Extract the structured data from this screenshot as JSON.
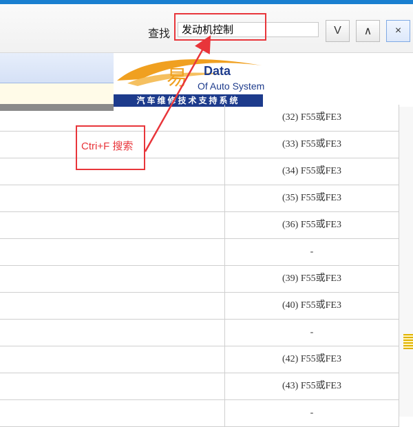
{
  "find": {
    "label": "查找",
    "query": "发动机控制",
    "down_label": "V",
    "up_label": "∧",
    "close_label": "×"
  },
  "logo": {
    "wordmark": "易",
    "name": "Data",
    "subtitle": "Of Auto System",
    "slogan": "汽车维修技术支持系统"
  },
  "annotation": {
    "text": "Ctri+F  搜索",
    "color": "#e8353a"
  },
  "table": {
    "rows": [
      "(32) F55或FE3",
      "(33) F55或FE3",
      "(34) F55或FE3",
      "(35) F55或FE3",
      "(36) F55或FE3",
      "-",
      "(39) F55或FE3",
      "(40) F55或FE3",
      "-",
      "(42) F55或FE3",
      "(43) F55或FE3",
      "-"
    ]
  },
  "colors": {
    "accent": "#1a7fd0",
    "highlight": "#e8353a",
    "logo_blue": "#1d3b8c",
    "logo_orange": "#f0a020"
  }
}
